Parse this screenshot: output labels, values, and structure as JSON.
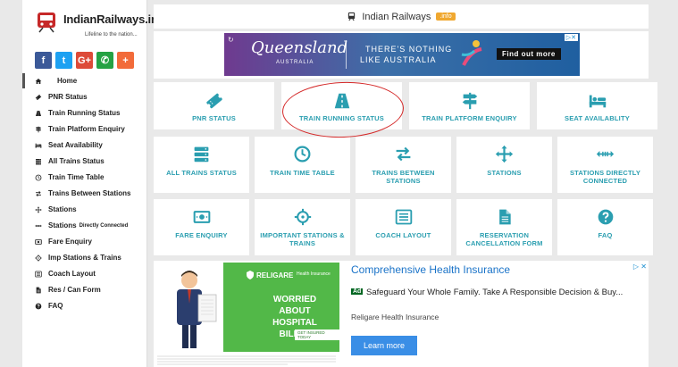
{
  "brand": {
    "name": "IndianRailways.info",
    "tagline": "Lifeline to the nation..."
  },
  "social": [
    {
      "name": "facebook",
      "glyph": "f",
      "color": "#3b5998"
    },
    {
      "name": "twitter",
      "glyph": "t",
      "color": "#1da1f2"
    },
    {
      "name": "google-plus",
      "glyph": "G+",
      "color": "#dd4b39"
    },
    {
      "name": "whatsapp",
      "glyph": "✆",
      "color": "#25a244"
    },
    {
      "name": "share",
      "glyph": "+",
      "color": "#f26b3a"
    }
  ],
  "menu": [
    {
      "label": "Home",
      "icon": "home-icon",
      "extra": ""
    },
    {
      "label": "PNR Status",
      "icon": "ticket-icon",
      "extra": ""
    },
    {
      "label": "Train Running Status",
      "icon": "road-icon",
      "extra": ""
    },
    {
      "label": "Train Platform Enquiry",
      "icon": "signpost-icon",
      "extra": ""
    },
    {
      "label": "Seat Availability",
      "icon": "bed-icon",
      "extra": ""
    },
    {
      "label": "All Trains Status",
      "icon": "server-icon",
      "extra": ""
    },
    {
      "label": "Train Time Table",
      "icon": "clock-icon",
      "extra": ""
    },
    {
      "label": "Trains Between Stations",
      "icon": "swap-icon",
      "extra": ""
    },
    {
      "label": "Stations",
      "icon": "move-icon",
      "extra": ""
    },
    {
      "label": "Stations",
      "icon": "connection-icon",
      "extra": "Directly Connected"
    },
    {
      "label": "Fare Enquiry",
      "icon": "money-icon",
      "extra": ""
    },
    {
      "label": "Imp Stations & Trains",
      "icon": "crosshair-icon",
      "extra": ""
    },
    {
      "label": "Coach Layout",
      "icon": "list-icon",
      "extra": ""
    },
    {
      "label": "Res / Can Form",
      "icon": "file-icon",
      "extra": ""
    },
    {
      "label": "FAQ",
      "icon": "question-icon",
      "extra": ""
    }
  ],
  "header": {
    "title": "Indian Railways",
    "badge": ".info"
  },
  "top_ad": {
    "brand": "Queensland",
    "brand_sub": "AUSTRALIA",
    "line1": "THERE'S NOTHING",
    "line2": "LIKE AUSTRALIA",
    "cta": "Find out more"
  },
  "tiles": [
    {
      "label": "PNR STATUS",
      "icon": "ticket-icon"
    },
    {
      "label": "TRAIN RUNNING STATUS",
      "icon": "road-icon"
    },
    {
      "label": "TRAIN PLATFORM ENQUIRY",
      "icon": "signpost-icon"
    },
    {
      "label": "SEAT AVAILABLITY",
      "icon": "bed-icon"
    },
    {
      "label": "ALL TRAINS STATUS",
      "icon": "server-icon"
    },
    {
      "label": "TRAIN TIME TABLE",
      "icon": "clock-icon"
    },
    {
      "label": "TRAINS BETWEEN STATIONS",
      "icon": "swap-icon"
    },
    {
      "label": "STATIONS",
      "icon": "move-icon"
    },
    {
      "label": "STATIONS DIRECTLY CONNECTED",
      "icon": "connection-icon"
    },
    {
      "label": "FARE ENQUIRY",
      "icon": "money-icon"
    },
    {
      "label": "IMPORTANT STATIONS & TRAINS",
      "icon": "crosshair-icon"
    },
    {
      "label": "COACH LAYOUT",
      "icon": "list-icon"
    },
    {
      "label": "RESERVATION CANCELLATION FORM",
      "icon": "file-icon"
    },
    {
      "label": "FAQ",
      "icon": "question-icon"
    }
  ],
  "bottom_ad": {
    "heading": "Comprehensive Health Insurance",
    "ad_badge": "Ad",
    "description": "Safeguard Your Whole Family. Take A Responsible Decision & Buy...",
    "advertiser": "Religare Health Insurance",
    "button": "Learn more",
    "image_brand": "RELIGARE",
    "image_brand_sub": "Health Insurance",
    "image_headline": "WORRIED ABOUT HOSPITAL BILLS?",
    "image_cta": "GET INSURED TODAY"
  },
  "colors": {
    "accent": "#2a9eb0",
    "annotation": "#d42828",
    "badge": "#f0a830"
  }
}
